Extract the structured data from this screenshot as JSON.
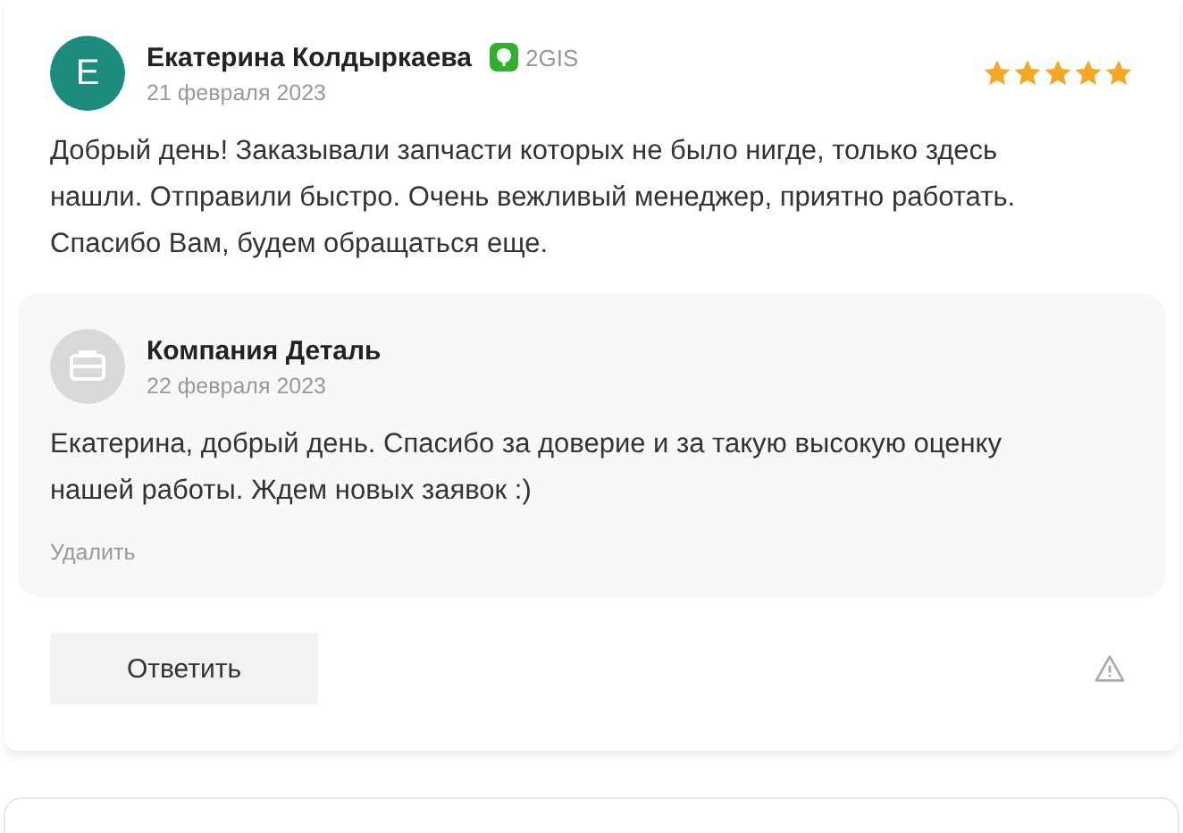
{
  "review": {
    "author": {
      "initial": "E",
      "name": "Екатерина Колдыркаева"
    },
    "source": "2GIS",
    "date": "21 февраля 2023",
    "stars": 5,
    "text": "Добрый день! Заказывали запчасти которых не было нигде, только здесь нашли. Отправили быстро. Очень вежливый менеджер, приятно работать. Спасибо Вам, будем обращаться еще.",
    "reply": {
      "company": "Компания Деталь",
      "date": "22 февраля 2023",
      "text": "Екатерина, добрый день. Спасибо за доверие и за такую высокую оценку нашей работы. Ждем новых заявок :)",
      "delete_label": "Удалить"
    },
    "reply_button": "Ответить"
  }
}
